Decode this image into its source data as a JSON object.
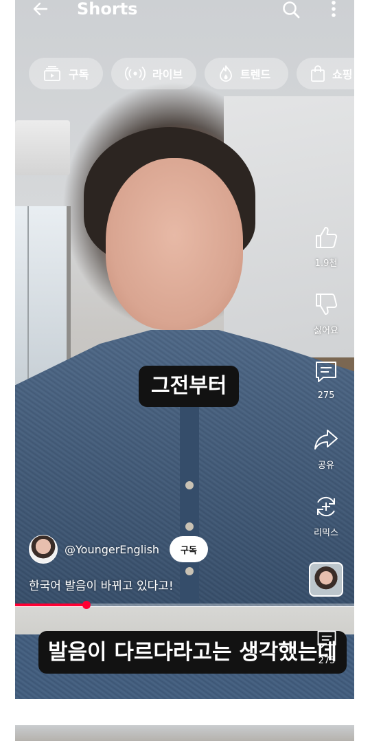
{
  "topbar": {
    "title": "Shorts",
    "icons": [
      "back-arrow-icon",
      "search-icon",
      "more-vert-icon"
    ]
  },
  "chips": [
    {
      "label": "구독",
      "icon": "subscriptions-icon"
    },
    {
      "label": "라이브",
      "icon": "live-icon"
    },
    {
      "label": "트렌드",
      "icon": "trending-flame-icon"
    },
    {
      "label": "쇼핑",
      "icon": "shopping-bag-icon"
    }
  ],
  "actions": {
    "like": {
      "label": "1.9천",
      "icon": "thumb-up-icon"
    },
    "dislike": {
      "label": "싫어요",
      "icon": "thumb-down-icon"
    },
    "comments": {
      "label": "275",
      "icon": "comment-icon"
    },
    "share": {
      "label": "공유",
      "icon": "share-icon"
    },
    "remix": {
      "label": "리믹스",
      "icon": "remix-icon"
    }
  },
  "video": {
    "caption": "그전부터",
    "channel_handle": "@YoungerEnglish",
    "subscribe_label": "구독",
    "description": "한국어 발음이 바뀌고 있다고!",
    "progress": 0.21
  },
  "next_video": {
    "caption": "발음이 다르다라고는 생각했는데",
    "comments": "275"
  },
  "colors": {
    "accent": "#ff0033",
    "caption_bg": "#121212",
    "text": "#ffffff"
  }
}
